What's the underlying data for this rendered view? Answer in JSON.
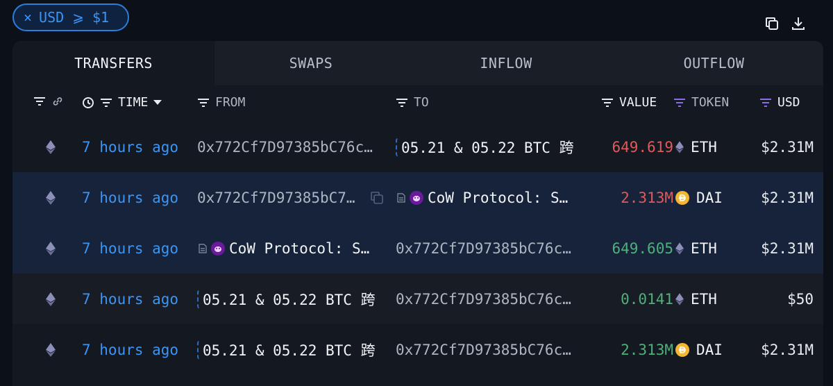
{
  "filter_chip": {
    "close": "×",
    "label": "USD ⩾ $1"
  },
  "top_icons": [
    "copy-icon",
    "download-icon"
  ],
  "tabs": [
    {
      "label": "TRANSFERS",
      "active": true
    },
    {
      "label": "SWAPS",
      "active": false
    },
    {
      "label": "INFLOW",
      "active": false
    },
    {
      "label": "OUTFLOW",
      "active": false
    }
  ],
  "columns": {
    "time": "TIME",
    "from": "FROM",
    "to": "TO",
    "value": "VALUE",
    "token": "TOKEN",
    "usd": "USD"
  },
  "rows": [
    {
      "time": "7 hours ago",
      "from": "0x772Cf7D97385bC76c…",
      "to": "05.21 & 05.22 BTC 跨",
      "value": "649.619",
      "value_color": "red",
      "token": "ETH",
      "usd": "$2.31M"
    },
    {
      "time": "7 hours ago",
      "from": "0x772Cf7D97385bC7…",
      "to": "CoW Protocol: S…",
      "value": "2.313M",
      "value_color": "red",
      "token": "DAI",
      "usd": "$2.31M"
    },
    {
      "time": "7 hours ago",
      "from": "CoW Protocol: S…",
      "to": "0x772Cf7D97385bC76c…",
      "value": "649.605",
      "value_color": "green",
      "token": "ETH",
      "usd": "$2.31M"
    },
    {
      "time": "7 hours ago",
      "from": "05.21 & 05.22 BTC 跨",
      "to": "0x772Cf7D97385bC76c…",
      "value": "0.0141",
      "value_color": "green",
      "token": "ETH",
      "usd": "$50"
    },
    {
      "time": "7 hours ago",
      "from": "05.21 & 05.22 BTC 跨",
      "to": "0x772Cf7D97385bC76c…",
      "value": "2.313M",
      "value_color": "green",
      "token": "DAI",
      "usd": "$2.31M"
    }
  ]
}
